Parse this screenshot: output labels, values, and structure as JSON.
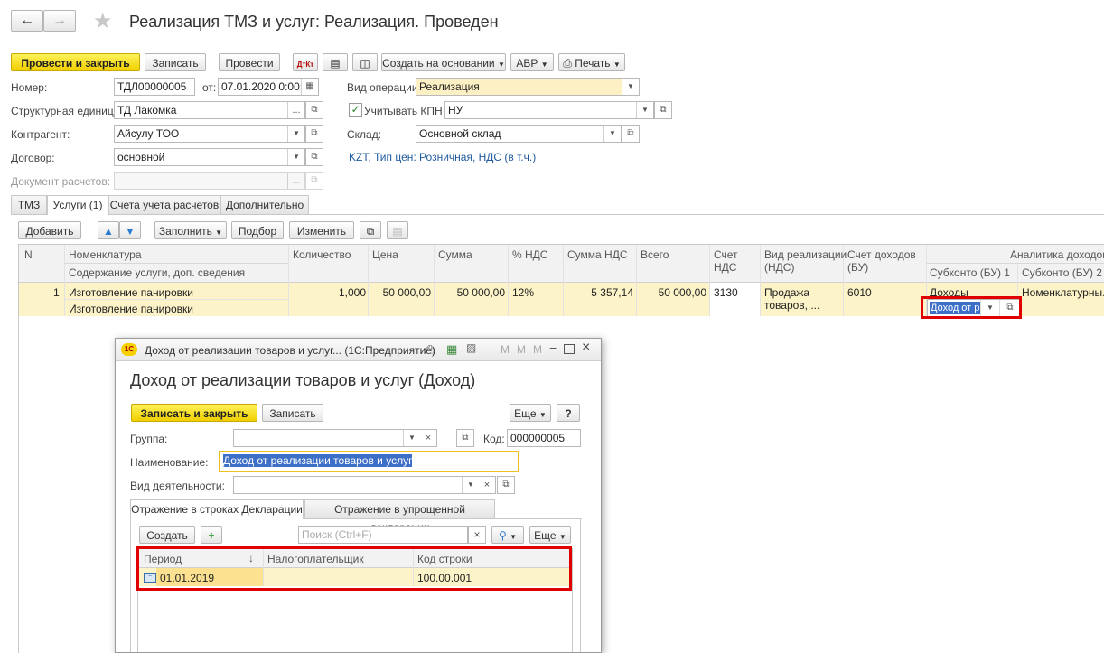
{
  "header": {
    "title": "Реализация ТМЗ и услуг: Реализация. Проведен"
  },
  "toolbar": {
    "post_close": "Провести и закрыть",
    "save": "Записать",
    "post": "Провести",
    "create_based": "Создать на основании",
    "avr": "АВР",
    "print": "Печать"
  },
  "form": {
    "number_label": "Номер:",
    "number_value": "ТДЛ00000005",
    "date_label": "от:",
    "date_value": "07.01.2020  0:00:00",
    "operation_label": "Вид операции:",
    "operation_value": "Реализация",
    "unit_label": "Структурная единица:",
    "unit_value": "ТД Лакомка",
    "kpn_label": "Учитывать КПН",
    "kpn_value": "НУ",
    "counterparty_label": "Контрагент:",
    "counterparty_value": "Айсулу ТОО",
    "warehouse_label": "Склад:",
    "warehouse_value": "Основной склад",
    "contract_label": "Договор:",
    "contract_value": "основной",
    "price_info": "KZT, Тип цен: Розничная, НДС (в т.ч.)",
    "settlement_label": "Документ расчетов:"
  },
  "tabs": [
    "ТМЗ",
    "Услуги (1)",
    "Счета учета расчетов",
    "Дополнительно"
  ],
  "table_toolbar": {
    "add": "Добавить",
    "fill": "Заполнить",
    "pick": "Подбор",
    "change": "Изменить"
  },
  "table": {
    "headers": {
      "n": "N",
      "nomenclature": "Номенклатура",
      "content": "Содержание услуги, доп. сведения",
      "qty": "Количество",
      "price": "Цена",
      "sum": "Сумма",
      "vat_pct": "% НДС",
      "vat_sum": "Сумма НДС",
      "total": "Всего",
      "vat_acc_1": "Счет",
      "vat_acc_2": "НДС",
      "sale_type_1": "Вид реализации",
      "sale_type_2": "(НДС)",
      "income_acc_1": "Счет доходов",
      "income_acc_2": "(БУ)",
      "analytics": "Аналитика доходов (",
      "sub1": "Субконто (БУ) 1",
      "sub2": "Субконто (БУ) 2"
    },
    "row": {
      "n": "1",
      "nomenclature": "Изготовление панировки",
      "content": "Изготовление панировки",
      "qty": "1,000",
      "price": "50 000,00",
      "sum": "50 000,00",
      "vat_pct": "12%",
      "vat_sum": "5 357,14",
      "total": "50 000,00",
      "vat_acc": "3130",
      "sale_type_1": "Продажа",
      "sale_type_2": "товаров, ...",
      "income_acc": "6010",
      "sub1": "Доходы",
      "sub2": "Номенклатурны...",
      "edit_value": "Доход от р"
    }
  },
  "dialog": {
    "window_title": "Доход от реализации товаров и услуг... (1С:Предприятие)",
    "heading": "Доход от реализации товаров и услуг (Доход)",
    "save_close": "Записать и закрыть",
    "save": "Записать",
    "more": "Еще",
    "help": "?",
    "group_label": "Группа:",
    "code_label": "Код:",
    "code_value": "000000005",
    "name_label": "Наименование:",
    "name_value": "Доход от реализации товаров и услуг",
    "activity_label": "Вид деятельности:",
    "tabs": [
      "Отражение в строках Декларации",
      "Отражение в упрощенной декларации"
    ],
    "create": "Создать",
    "search_placeholder": "Поиск (Ctrl+F)",
    "more2": "Еще",
    "grid_headers": {
      "period": "Период",
      "taxpayer": "Налогоплательщик",
      "line_code": "Код строки"
    },
    "grid_row": {
      "period": "01.01.2019",
      "taxpayer": "",
      "line_code": "100.00.001"
    }
  },
  "colors": {
    "accent_yellow": "#f5d800",
    "highlight_row": "#fdf3c8",
    "red_box": "#e00000",
    "link_blue": "#1f5a9e"
  }
}
